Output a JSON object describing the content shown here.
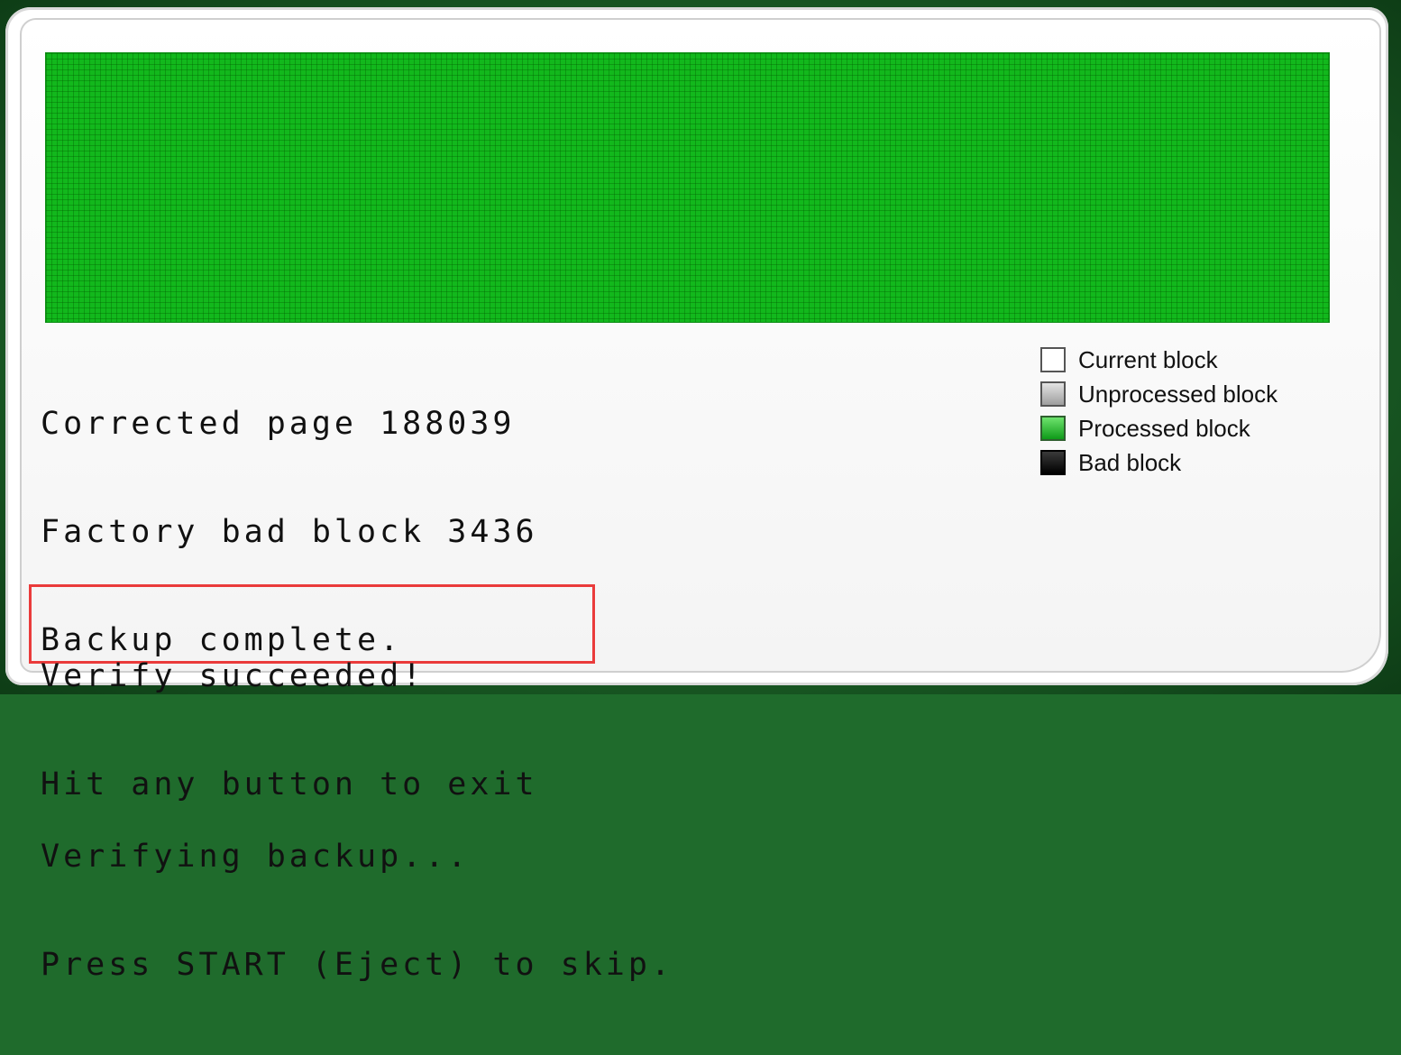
{
  "console": {
    "lines": [
      "Corrected page 188039",
      "Factory bad block 3436",
      "Backup complete.",
      "",
      "Verifying backup...",
      "Press START (Eject) to skip."
    ],
    "highlighted_lines": [
      "Verify succeeded!",
      "Hit any button to exit"
    ]
  },
  "legend": {
    "items": [
      {
        "label": "Current block",
        "color": "#ffffff"
      },
      {
        "label": "Unprocessed block",
        "color": "#bdbdbd"
      },
      {
        "label": "Processed block",
        "color": "#12b81c"
      },
      {
        "label": "Bad block",
        "color": "#000000"
      }
    ]
  },
  "block_map": {
    "color": "#12b81c",
    "processed_fraction": 1.0
  },
  "highlight": {
    "border_color": "#ea3b3b"
  }
}
